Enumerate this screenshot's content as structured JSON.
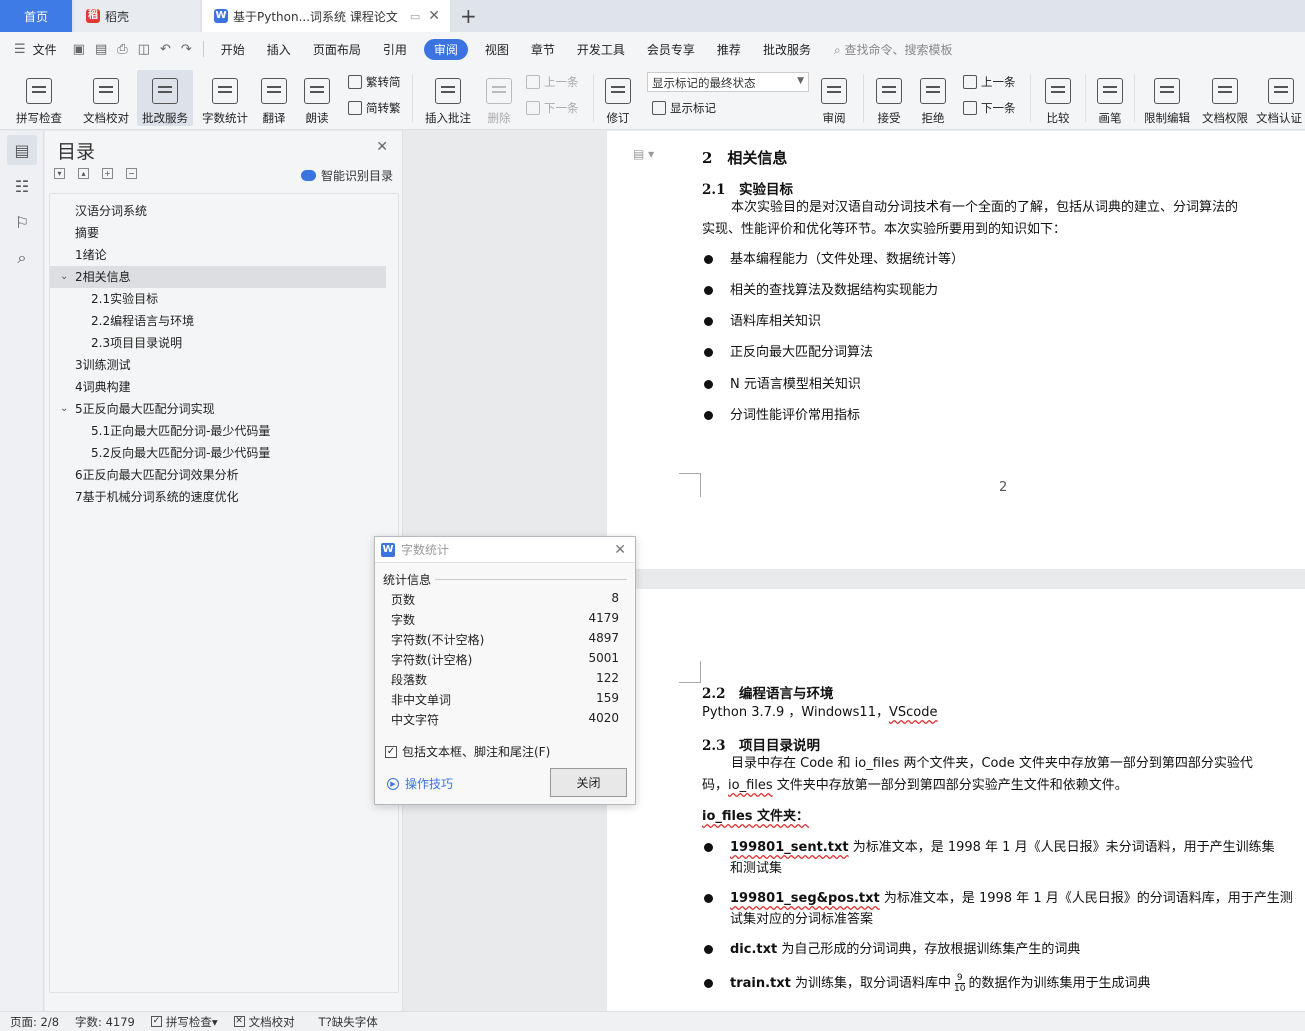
{
  "tabs": {
    "home": "首页",
    "daoke": "稻壳",
    "doc": "基于Python...词系统 课程论文"
  },
  "menu": {
    "file": "文件",
    "items": [
      "开始",
      "插入",
      "页面布局",
      "引用",
      "审阅",
      "视图",
      "章节",
      "开发工具",
      "会员专享",
      "推荐",
      "批改服务"
    ],
    "active_index": 4,
    "search": "查找命令、搜索模板"
  },
  "ribbon": {
    "spell_check": "拼写检查",
    "doc_check": "文档校对",
    "revise_service": "批改服务",
    "word_count": "字数统计",
    "translate": "翻译",
    "read_aloud": "朗读",
    "trad_to_simp": "繁转简",
    "simp_to_trad": "简转繁",
    "insert_comment": "插入批注",
    "delete": "删除",
    "prev_comment": "上一条",
    "next_comment": "下一条",
    "track_changes": "修订",
    "markup_state": "显示标记的最终状态",
    "show_markup": "显示标记",
    "review": "审阅",
    "accept": "接受",
    "reject": "拒绝",
    "prev_change": "上一条",
    "next_change": "下一条",
    "compare": "比较",
    "pen": "画笔",
    "restrict_edit": "限制编辑",
    "doc_permission": "文档权限",
    "doc_auth": "文档认证"
  },
  "toc": {
    "title": "目录",
    "smart": "智能识别目录",
    "items": [
      {
        "label": "汉语分词系统",
        "level": 1
      },
      {
        "label": "摘要",
        "level": 1
      },
      {
        "label": "1绪论",
        "level": 1
      },
      {
        "label": "2相关信息",
        "level": 1
      },
      {
        "label": "2.1实验目标",
        "level": 2
      },
      {
        "label": "2.2编程语言与环境",
        "level": 2
      },
      {
        "label": "2.3项目目录说明",
        "level": 2
      },
      {
        "label": "3训练测试",
        "level": 1
      },
      {
        "label": "4词典构建",
        "level": 1
      },
      {
        "label": "5正反向最大匹配分词实现",
        "level": 1
      },
      {
        "label": "5.1正向最大匹配分词-最少代码量",
        "level": 2
      },
      {
        "label": "5.2反向最大匹配分词-最少代码量",
        "level": 2
      },
      {
        "label": "6正反向最大匹配分词效果分析",
        "level": 1
      },
      {
        "label": "7基于机械分词系统的速度优化",
        "level": 1
      }
    ]
  },
  "page1": {
    "h2": "2　相关信息",
    "h3": "2.1　实验目标",
    "para_line1": "本次实验目的是对汉语自动分词技术有一个全面的了解，包括从词典的建立、分词算法的",
    "para_line2": "实现、性能评价和优化等环节。本次实验所要用到的知识如下：",
    "bullets": [
      "基本编程能力（文件处理、数据统计等）",
      "相关的查找算法及数据结构实现能力",
      "语料库相关知识",
      "正反向最大匹配分词算法",
      "N 元语言模型相关知识",
      "分词性能评价常用指标"
    ],
    "page_number": "2"
  },
  "page2": {
    "h3_env": "2.2　编程语言与环境",
    "env_pre": "Python 3.7.9 ，Windows11，",
    "env_vscode": "VScode",
    "h3_dir": "2.3　项目目录说明",
    "dir_line1": "目录中存在 Code 和 io_files 两个文件夹，Code 文件夹中存放第一部分到第四部分实验代",
    "dir_line2_pre": "码，",
    "dir_line2_io": "io_files",
    "dir_line2_post": " 文件夹中存放第一部分到第四部分实验产生文件和依赖文件。",
    "io_heading": "io_files 文件夹：",
    "b1_file": "199801_sent.txt",
    "b1_text1": " 为标准文本，是 1998 年 1 月《人民日报》未分词语料，用于产生训练集",
    "b1_text2": "和测试集",
    "b2_file": "199801_seg&pos.txt",
    "b2_text1": " 为标准文本，是 1998 年 1 月《人民日报》的分词语料库，用于产生测",
    "b2_text2": "试集对应的分词标准答案",
    "b3_file": "dic.txt",
    "b3_text": " 为自己形成的分词词典，存放根据训练集产生的词典",
    "b4_file": "train.txt",
    "b4_text_pre": " 为训练集，取分词语料库中",
    "b4_num": "9",
    "b4_den": "10",
    "b4_text_post": "的数据作为训练集用于生成词典"
  },
  "word_count_dialog": {
    "title": "字数统计",
    "group": "统计信息",
    "rows": [
      {
        "label": "页数",
        "value": "8"
      },
      {
        "label": "字数",
        "value": "4179"
      },
      {
        "label": "字符数(不计空格)",
        "value": "4897"
      },
      {
        "label": "字符数(计空格)",
        "value": "5001"
      },
      {
        "label": "段落数",
        "value": "122"
      },
      {
        "label": "非中文单词",
        "value": "159"
      },
      {
        "label": "中文字符",
        "value": "4020"
      }
    ],
    "checkbox_label": "包括文本框、脚注和尾注(F)",
    "checkbox_checked": true,
    "tips": "操作技巧",
    "close_button": "关闭"
  },
  "status": {
    "page": "页面: 2/8",
    "words": "字数: 4179",
    "spell": "拼写检查",
    "doc_check": "文档校对",
    "missing_font": "缺失字体"
  },
  "colors": {
    "accent": "#3b74e0"
  }
}
